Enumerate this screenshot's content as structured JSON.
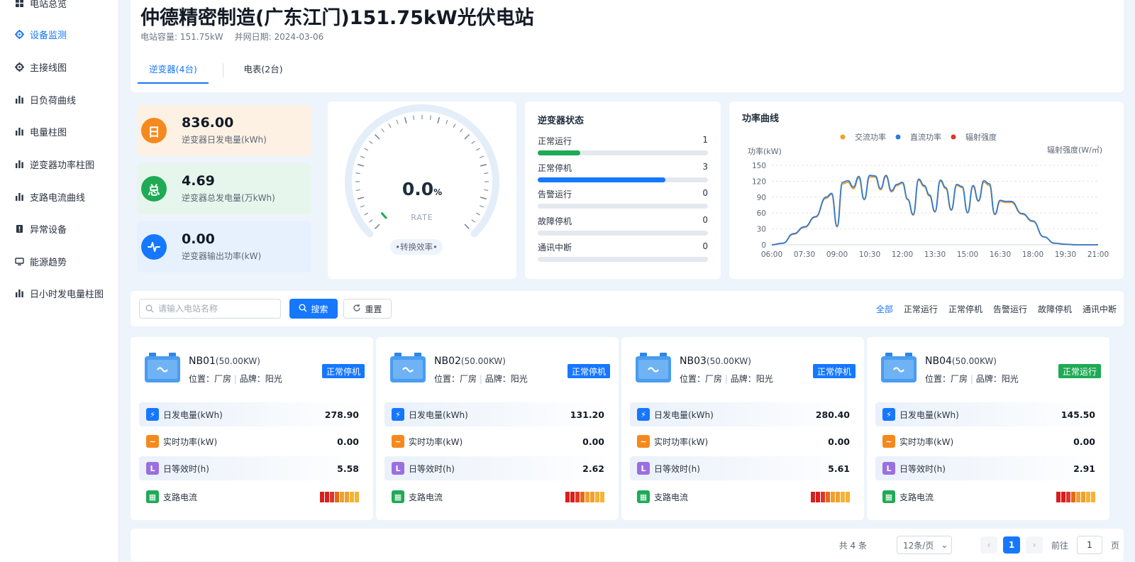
{
  "sidebar": {
    "items": [
      {
        "label": "电站总览",
        "icon": "grid-icon"
      },
      {
        "label": "设备监测",
        "icon": "monitor-icon",
        "active": true
      },
      {
        "label": "主接线图",
        "icon": "wiring-icon"
      },
      {
        "label": "日负荷曲线",
        "icon": "bar-chart-icon"
      },
      {
        "label": "电量柱图",
        "icon": "bar-chart-icon"
      },
      {
        "label": "逆变器功率柱图",
        "icon": "bar-chart-icon"
      },
      {
        "label": "支路电流曲线",
        "icon": "bar-chart-icon"
      },
      {
        "label": "异常设备",
        "icon": "alert-device-icon"
      },
      {
        "label": "能源趋势",
        "icon": "screen-icon"
      },
      {
        "label": "日小时发电量柱图",
        "icon": "bar-chart-icon"
      }
    ]
  },
  "header": {
    "title": "仲德精密制造(广东江门)151.75kW光伏电站",
    "capacity": "电站容量: 151.75kW",
    "grid_date": "并网日期: 2024-03-06",
    "tabs": [
      "逆变器(4台)",
      "电表(2台)"
    ]
  },
  "stats": [
    {
      "badge": "日",
      "value": "836.00",
      "label": "逆变器日发电量(kWh)",
      "color": "#f5891d",
      "bg": "#fdf1e4"
    },
    {
      "badge": "总",
      "value": "4.69",
      "label": "逆变器总发电量(万kWh)",
      "color": "#1faa55",
      "bg": "#e6f6ec"
    },
    {
      "badge": "~",
      "value": "0.00",
      "label": "逆变器输出功率(kW)",
      "color": "#1677ff",
      "bg": "#e6f1fd"
    }
  ],
  "gauge": {
    "value": "0.0",
    "unit": "%",
    "caption": "RATE",
    "label": "转换效率",
    "fraction": 0.0
  },
  "inverter_status": {
    "title": "逆变器状态",
    "total": 4,
    "rows": [
      {
        "name": "正常运行",
        "count": 1,
        "color": "#1faa55"
      },
      {
        "name": "正常停机",
        "count": 3,
        "color": "#1677ff"
      },
      {
        "name": "告警运行",
        "count": 0,
        "color": "#f5891d"
      },
      {
        "name": "故障停机",
        "count": 0,
        "color": "#e0352b"
      },
      {
        "name": "通讯中断",
        "count": 0,
        "color": "#8a94a3"
      }
    ]
  },
  "power_chart": {
    "title": "功率曲线",
    "ylabel_left": "功率(kW)",
    "ylabel_right": "辐射强度(W/㎡)",
    "legend": [
      {
        "name": "交流功率",
        "color": "#f0a030"
      },
      {
        "name": "直流功率",
        "color": "#2f7bd8"
      },
      {
        "name": "辐射强度",
        "color": "#e0352b"
      }
    ]
  },
  "chart_data": {
    "type": "line",
    "title": "功率曲线",
    "xlabel": "",
    "ylabel": "功率(kW)",
    "ylim": [
      0,
      150
    ],
    "yticks": [
      0,
      30,
      60,
      90,
      120,
      150
    ],
    "xticks": [
      "06:00",
      "07:30",
      "09:00",
      "10:30",
      "12:00",
      "13:30",
      "15:00",
      "16:30",
      "18:00",
      "19:30",
      "21:00"
    ],
    "x": [
      "06:00",
      "06:30",
      "07:00",
      "07:30",
      "08:00",
      "08:30",
      "08:45",
      "09:00",
      "09:15",
      "09:30",
      "09:45",
      "10:00",
      "10:15",
      "10:30",
      "10:45",
      "11:00",
      "11:15",
      "11:30",
      "11:45",
      "12:00",
      "12:15",
      "12:30",
      "12:45",
      "13:00",
      "13:15",
      "13:30",
      "13:45",
      "14:00",
      "14:15",
      "14:30",
      "14:45",
      "15:00",
      "15:15",
      "15:30",
      "15:45",
      "16:00",
      "16:15",
      "16:30",
      "16:45",
      "17:00",
      "17:30",
      "18:00",
      "18:30",
      "19:00",
      "19:30",
      "20:00",
      "20:30",
      "21:00"
    ],
    "series": [
      {
        "name": "交流功率",
        "color": "#f0a030",
        "values": [
          0,
          3,
          20,
          33,
          52,
          88,
          95,
          34,
          115,
          118,
          106,
          126,
          85,
          128,
          128,
          104,
          129,
          100,
          112,
          116,
          85,
          56,
          122,
          110,
          92,
          62,
          120,
          106,
          65,
          112,
          108,
          60,
          110,
          82,
          118,
          112,
          57,
          82,
          80,
          80,
          58,
          44,
          15,
          3,
          1,
          0,
          0,
          0
        ]
      },
      {
        "name": "直流功率",
        "color": "#2f7bd8",
        "values": [
          0,
          3,
          21,
          34,
          53,
          90,
          97,
          35,
          118,
          121,
          109,
          129,
          86,
          131,
          130,
          106,
          131,
          102,
          114,
          118,
          86,
          57,
          124,
          112,
          94,
          63,
          122,
          108,
          66,
          114,
          110,
          61,
          112,
          83,
          121,
          115,
          58,
          84,
          82,
          82,
          59,
          45,
          15,
          3,
          1,
          0,
          0,
          0
        ]
      },
      {
        "name": "辐射强度",
        "color": "#e0352b",
        "values": []
      }
    ]
  },
  "toolbar": {
    "search_placeholder": "请输入电站名称",
    "search_label": "搜索",
    "reset_label": "重置",
    "filters": [
      "全部",
      "正常运行",
      "正常停机",
      "告警运行",
      "故障停机",
      "通讯中断"
    ]
  },
  "metric_labels": {
    "daily": "日发电量(kWh)",
    "power": "实时功率(kW)",
    "hours": "日等效时(h)",
    "branch": "支路电流"
  },
  "inverters": [
    {
      "name": "NB01",
      "capacity": "(50.00KW)",
      "location": "位置：厂房",
      "brand": "品牌：阳光",
      "status": "正常停机",
      "status_color": "#1677ff",
      "daily": "278.90",
      "power": "0.00",
      "hours": "5.58",
      "branch_colors": [
        "#d81e1e",
        "#d81e1e",
        "#e0352b",
        "#e56a14",
        "#f0a030",
        "#f0a030",
        "#f5b335",
        "#f5b335"
      ]
    },
    {
      "name": "NB02",
      "capacity": "(50.00KW)",
      "location": "位置：厂房",
      "brand": "品牌：阳光",
      "status": "正常停机",
      "status_color": "#1677ff",
      "daily": "131.20",
      "power": "0.00",
      "hours": "2.62",
      "branch_colors": [
        "#d81e1e",
        "#d81e1e",
        "#e0352b",
        "#e56a14",
        "#f0a030",
        "#f0a030",
        "#f5b335",
        "#f5b335"
      ]
    },
    {
      "name": "NB03",
      "capacity": "(50.00KW)",
      "location": "位置：厂房",
      "brand": "品牌：阳光",
      "status": "正常停机",
      "status_color": "#1677ff",
      "daily": "280.40",
      "power": "0.00",
      "hours": "5.61",
      "branch_colors": [
        "#d81e1e",
        "#d81e1e",
        "#e0352b",
        "#e56a14",
        "#f0a030",
        "#f0a030",
        "#f5b335",
        "#f5b335"
      ]
    },
    {
      "name": "NB04",
      "capacity": "(50.00KW)",
      "location": "位置：厂房",
      "brand": "品牌：阳光",
      "status": "正常运行",
      "status_color": "#1faa55",
      "daily": "145.50",
      "power": "0.00",
      "hours": "2.91",
      "branch_colors": [
        "#d81e1e",
        "#d81e1e",
        "#e0352b",
        "#e56a14",
        "#f0a030",
        "#f0a030",
        "#f5b335",
        "#f5b335"
      ]
    }
  ],
  "pagination": {
    "total": "共 4 条",
    "page_size": "12条/页",
    "current": "1",
    "goto_label": "前往",
    "goto_value": "1",
    "page_suffix": "页"
  }
}
